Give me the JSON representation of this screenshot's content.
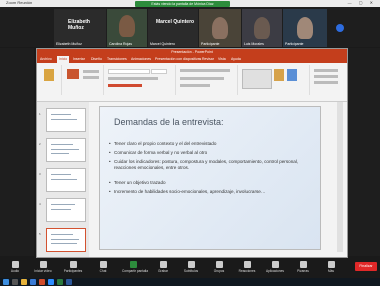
{
  "zoom": {
    "window_title": "Zoom Reunión",
    "share_banner": "Estás viendo la pantalla de Mónica Díaz",
    "participants": [
      {
        "name": "Elizabeth Muñoz"
      },
      {
        "name": "Carolina Rojas"
      },
      {
        "name": "Marcel Quintero"
      },
      {
        "name": "Participante"
      },
      {
        "name": "Luis Morales"
      },
      {
        "name": "Participante"
      }
    ],
    "toolbar": [
      {
        "label": "Audio",
        "icon": "mic-icon"
      },
      {
        "label": "Iniciar vídeo",
        "icon": "video-icon"
      },
      {
        "label": "Participantes",
        "icon": "participants-icon"
      },
      {
        "label": "Chat",
        "icon": "chat-icon"
      },
      {
        "label": "Compartir pantalla",
        "icon": "share-icon"
      },
      {
        "label": "Grabar",
        "icon": "record-icon"
      },
      {
        "label": "Subtítulos",
        "icon": "cc-icon"
      },
      {
        "label": "Grupos",
        "icon": "rooms-icon"
      },
      {
        "label": "Reacciones",
        "icon": "reaction-icon"
      },
      {
        "label": "Aplicaciones",
        "icon": "apps-icon"
      },
      {
        "label": "Pizarras",
        "icon": "whiteboard-icon"
      },
      {
        "label": "Más",
        "icon": "more-icon"
      }
    ],
    "end_label": "Finalizar",
    "green_accent": "#2d8c3c"
  },
  "ppt": {
    "title": "Presentación - PowerPoint",
    "tabs": [
      "Archivo",
      "Inicio",
      "Insertar",
      "Diseño",
      "Transiciones",
      "Animaciones",
      "Presentación con diapositivas",
      "Revisar",
      "Vista",
      "Ayuda"
    ],
    "accent": "#c43e1c",
    "slide": {
      "title": "Demandas de la entrevista:",
      "bullets": [
        "Tener claro el propio contexto y el del entrevistado",
        "Comunicar de forma verbal y no verbal al otro",
        "Cuidar los indicadores: postura, compostura y modales, comportamiento, control personal, reacciones emocionales, entre otros.",
        "Tener un objetivo trazado",
        "Incremento de habilidades socio-emocionales, aprendizaje, involucrarse…"
      ]
    }
  }
}
